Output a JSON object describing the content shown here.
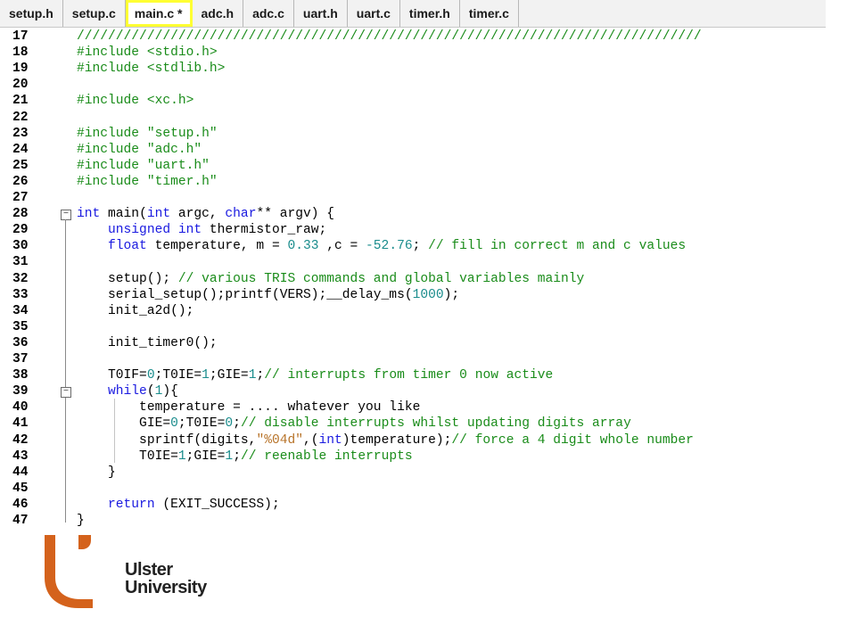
{
  "tabs": [
    {
      "label": "setup.h"
    },
    {
      "label": "setup.c"
    },
    {
      "label": "main.c *",
      "active": true
    },
    {
      "label": "adc.h"
    },
    {
      "label": "adc.c"
    },
    {
      "label": "uart.h"
    },
    {
      "label": "uart.c"
    },
    {
      "label": "timer.h"
    },
    {
      "label": "timer.c"
    }
  ],
  "editor": {
    "lines": [
      {
        "n": "17",
        "segs": [
          [
            "cm",
            "////////////////////////////////////////////////////////////////////////////////"
          ]
        ]
      },
      {
        "n": "18",
        "segs": [
          [
            "pp",
            "#include <stdio.h>"
          ]
        ]
      },
      {
        "n": "19",
        "segs": [
          [
            "pp",
            "#include <stdlib.h>"
          ]
        ]
      },
      {
        "n": "20",
        "segs": []
      },
      {
        "n": "21",
        "segs": [
          [
            "pp",
            "#include <xc.h>"
          ]
        ]
      },
      {
        "n": "22",
        "segs": []
      },
      {
        "n": "23",
        "segs": [
          [
            "pp",
            "#include \"setup.h\""
          ]
        ]
      },
      {
        "n": "24",
        "segs": [
          [
            "pp",
            "#include \"adc.h\""
          ]
        ]
      },
      {
        "n": "25",
        "segs": [
          [
            "pp",
            "#include \"uart.h\""
          ]
        ]
      },
      {
        "n": "26",
        "segs": [
          [
            "pp",
            "#include \"timer.h\""
          ]
        ]
      },
      {
        "n": "27",
        "segs": []
      },
      {
        "n": "28",
        "segs": [
          [
            "kw",
            "int"
          ],
          [
            "tx",
            " main("
          ],
          [
            "kw",
            "int"
          ],
          [
            "tx",
            " argc, "
          ],
          [
            "kw",
            "char"
          ],
          [
            "tx",
            "** argv) {"
          ]
        ]
      },
      {
        "n": "29",
        "segs": [
          [
            "tx",
            "    "
          ],
          [
            "kw",
            "unsigned int"
          ],
          [
            "tx",
            " thermistor_raw;"
          ]
        ]
      },
      {
        "n": "30",
        "segs": [
          [
            "tx",
            "    "
          ],
          [
            "kw",
            "float"
          ],
          [
            "tx",
            " temperature, m = "
          ],
          [
            "nm",
            "0.33"
          ],
          [
            "tx",
            " ,c = "
          ],
          [
            "nm",
            "-52.76"
          ],
          [
            "tx",
            "; "
          ],
          [
            "cm",
            "// fill in correct m and c values"
          ]
        ]
      },
      {
        "n": "31",
        "segs": []
      },
      {
        "n": "32",
        "segs": [
          [
            "tx",
            "    setup(); "
          ],
          [
            "cm",
            "// various TRIS commands and global variables mainly"
          ]
        ]
      },
      {
        "n": "33",
        "segs": [
          [
            "tx",
            "    serial_setup();printf(VERS);__delay_ms("
          ],
          [
            "nm",
            "1000"
          ],
          [
            "tx",
            ");"
          ]
        ]
      },
      {
        "n": "34",
        "segs": [
          [
            "tx",
            "    init_a2d();"
          ]
        ]
      },
      {
        "n": "35",
        "segs": []
      },
      {
        "n": "36",
        "segs": [
          [
            "tx",
            "    init_timer0();"
          ]
        ]
      },
      {
        "n": "37",
        "segs": []
      },
      {
        "n": "38",
        "segs": [
          [
            "tx",
            "    T0IF="
          ],
          [
            "nm",
            "0"
          ],
          [
            "tx",
            ";T0IE="
          ],
          [
            "nm",
            "1"
          ],
          [
            "tx",
            ";GIE="
          ],
          [
            "nm",
            "1"
          ],
          [
            "tx",
            ";"
          ],
          [
            "cm",
            "// interrupts from timer 0 now active"
          ]
        ]
      },
      {
        "n": "39",
        "segs": [
          [
            "tx",
            "    "
          ],
          [
            "kw",
            "while"
          ],
          [
            "tx",
            "("
          ],
          [
            "nm",
            "1"
          ],
          [
            "tx",
            "){"
          ]
        ]
      },
      {
        "n": "40",
        "segs": [
          [
            "tx",
            "        temperature = .... whatever you like"
          ]
        ]
      },
      {
        "n": "41",
        "segs": [
          [
            "tx",
            "        GIE="
          ],
          [
            "nm",
            "0"
          ],
          [
            "tx",
            ";T0IE="
          ],
          [
            "nm",
            "0"
          ],
          [
            "tx",
            ";"
          ],
          [
            "cm",
            "// disable interrupts whilst updating digits array"
          ]
        ]
      },
      {
        "n": "42",
        "segs": [
          [
            "tx",
            "        sprintf(digits,"
          ],
          [
            "st",
            "\"%04d\""
          ],
          [
            "tx",
            ",("
          ],
          [
            "kw",
            "int"
          ],
          [
            "tx",
            ")temperature);"
          ],
          [
            "cm",
            "// force a 4 digit whole number"
          ]
        ]
      },
      {
        "n": "43",
        "segs": [
          [
            "tx",
            "        T0IE="
          ],
          [
            "nm",
            "1"
          ],
          [
            "tx",
            ";GIE="
          ],
          [
            "nm",
            "1"
          ],
          [
            "tx",
            ";"
          ],
          [
            "cm",
            "// reenable interrupts"
          ]
        ]
      },
      {
        "n": "44",
        "segs": [
          [
            "tx",
            "    }"
          ]
        ]
      },
      {
        "n": "45",
        "segs": []
      },
      {
        "n": "46",
        "segs": [
          [
            "tx",
            "    "
          ],
          [
            "kw",
            "return"
          ],
          [
            "tx",
            " (EXIT_SUCCESS);"
          ]
        ]
      },
      {
        "n": "47",
        "segs": [
          [
            "tx",
            "}"
          ]
        ]
      }
    ]
  },
  "branding": {
    "line1": "Ulster",
    "line2": "University",
    "accent_color": "#d4621c"
  }
}
